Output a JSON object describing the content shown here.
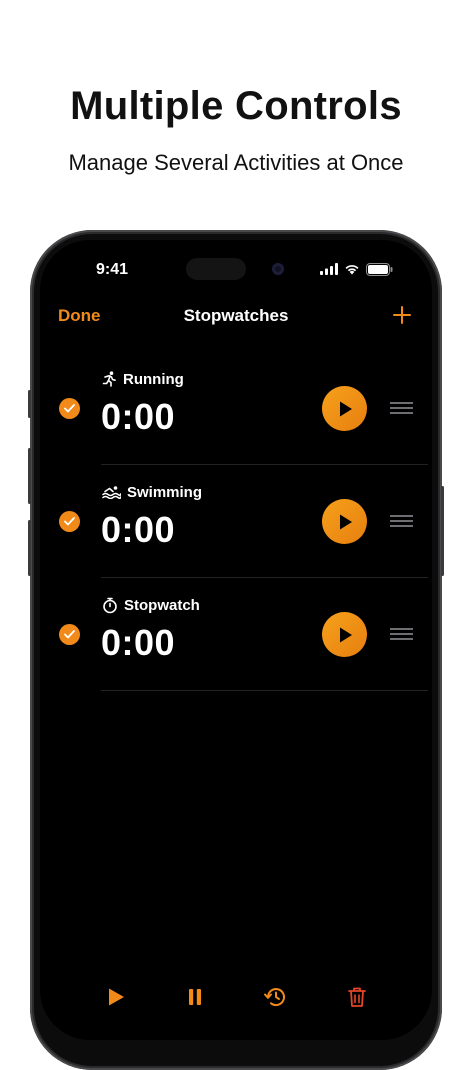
{
  "headline": "Multiple Controls",
  "subheadline": "Manage Several Activities at Once",
  "status_bar": {
    "time": "9:41"
  },
  "nav": {
    "left": "Done",
    "title": "Stopwatches",
    "right_icon": "plus-icon"
  },
  "stopwatches": [
    {
      "label": "Running",
      "icon": "running-icon",
      "time": "0:00",
      "checked": true
    },
    {
      "label": "Swimming",
      "icon": "swimming-icon",
      "time": "0:00",
      "checked": true
    },
    {
      "label": "Stopwatch",
      "icon": "stopwatch-icon",
      "time": "0:00",
      "checked": true
    }
  ],
  "toolbar": [
    "play-icon",
    "pause-icon",
    "history-icon",
    "trash-icon"
  ],
  "colors": {
    "accent": "#F28A1A",
    "delete": "#E5452A",
    "background": "#000000"
  }
}
